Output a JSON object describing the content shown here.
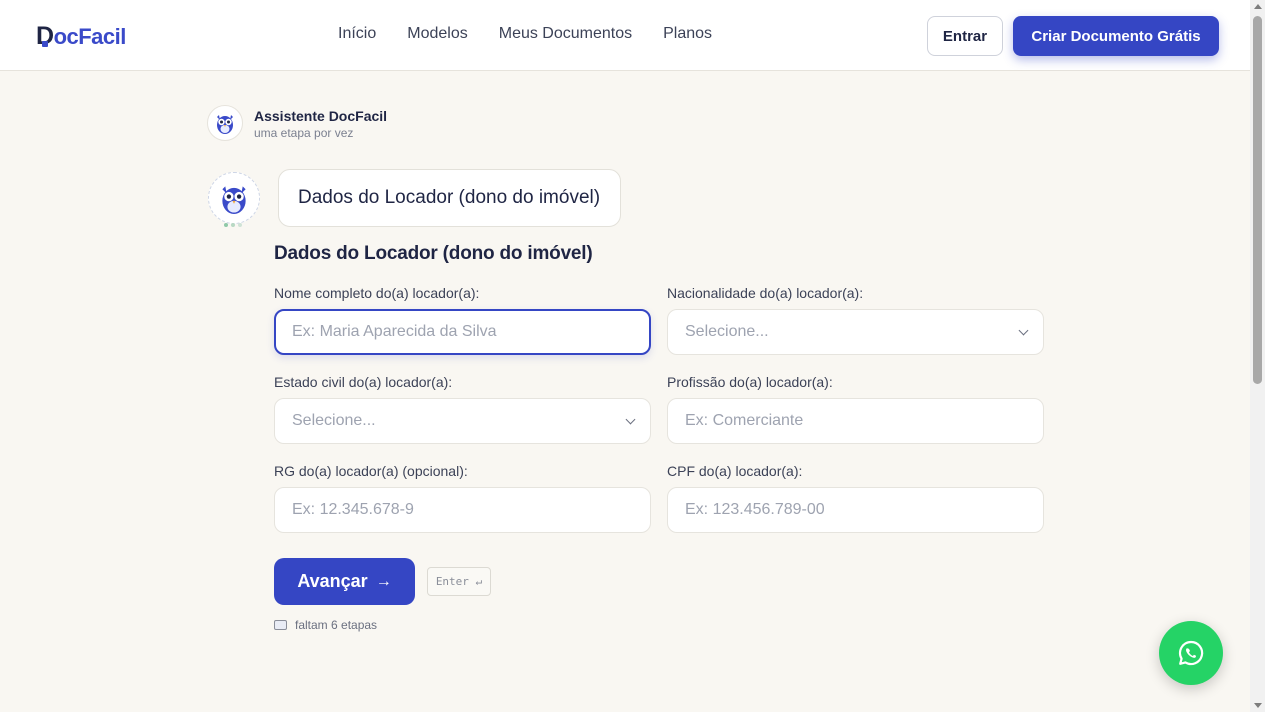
{
  "header": {
    "logo": {
      "first": "D",
      "rest": "ocFacil"
    },
    "nav": [
      "Início",
      "Modelos",
      "Meus Documentos",
      "Planos"
    ],
    "login_label": "Entrar",
    "cta_label": "Criar Documento Grátis"
  },
  "assistant": {
    "name": "Assistente DocFacil",
    "subtitle": "uma etapa por vez",
    "bubble": "Dados do Locador (dono do imóvel)"
  },
  "form": {
    "title": "Dados do Locador (dono do imóvel)",
    "fields": [
      {
        "label": "Nome completo do(a) locador(a):",
        "placeholder": "Ex: Maria Aparecida da Silva"
      },
      {
        "label": "Nacionalidade do(a) locador(a):",
        "placeholder": "Selecione..."
      },
      {
        "label": "Estado civil do(a) locador(a):",
        "placeholder": "Selecione..."
      },
      {
        "label": "Profissão do(a) locador(a):",
        "placeholder": "Ex: Comerciante"
      },
      {
        "label": "RG do(a) locador(a) (opcional):",
        "placeholder": "Ex: 12.345.678-9"
      },
      {
        "label": "CPF do(a) locador(a):",
        "placeholder": "Ex: 123.456.789-00"
      }
    ],
    "next_label": "Avançar",
    "next_arrow": "→",
    "enter_hint": "Enter ↵",
    "steps_left": "faltam 6 etapas"
  },
  "colors": {
    "brand": "#3546c4",
    "whatsapp": "#25d366",
    "background": "#f9f7f2"
  },
  "icons": {
    "owl": "owl-mascot-icon",
    "whatsapp": "whatsapp-icon",
    "steps": "card-icon"
  }
}
